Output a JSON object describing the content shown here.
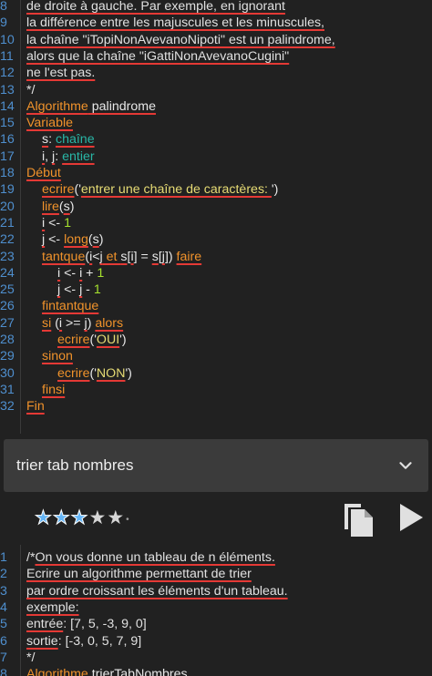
{
  "top_editor": {
    "lines": [
      {
        "n": "8",
        "indent": 0,
        "tokens": [
          {
            "t": "de droite à gauche. Par exemple, en ignorant",
            "c": "cm",
            "u": true
          }
        ]
      },
      {
        "n": "9",
        "indent": 0,
        "tokens": [
          {
            "t": "la différence entre les majuscules et les minuscules,",
            "c": "cm",
            "u": true
          }
        ]
      },
      {
        "n": "10",
        "indent": 0,
        "tokens": [
          {
            "t": "la chaîne \"iTopiNonAvevanoNipoti\" est un palindrome,",
            "c": "cm",
            "u": true
          }
        ]
      },
      {
        "n": "11",
        "indent": 0,
        "tokens": [
          {
            "t": "alors que la chaîne \"iGattiNonAvevanoCugini\"",
            "c": "cm",
            "u": true
          }
        ]
      },
      {
        "n": "12",
        "indent": 0,
        "tokens": [
          {
            "t": "ne l'est pas.",
            "c": "cm",
            "u": true
          }
        ]
      },
      {
        "n": "13",
        "indent": 0,
        "tokens": [
          {
            "t": "*/",
            "c": "cm",
            "u": false
          }
        ]
      },
      {
        "n": "14",
        "indent": 0,
        "tokens": [
          {
            "t": "Algorithme",
            "c": "kw",
            "u": true
          },
          {
            "t": " palindrome",
            "c": "id",
            "u": true
          }
        ]
      },
      {
        "n": "15",
        "indent": 0,
        "tokens": [
          {
            "t": "Variable",
            "c": "kw",
            "u": true
          }
        ]
      },
      {
        "n": "16",
        "indent": 1,
        "tokens": [
          {
            "t": "s",
            "c": "id",
            "u": true
          },
          {
            "t": ": ",
            "c": "op",
            "u": false
          },
          {
            "t": "chaîne",
            "c": "ty",
            "u": true
          }
        ]
      },
      {
        "n": "17",
        "indent": 1,
        "tokens": [
          {
            "t": "i",
            "c": "id",
            "u": true
          },
          {
            "t": ", ",
            "c": "op",
            "u": false
          },
          {
            "t": "j",
            "c": "id",
            "u": true
          },
          {
            "t": ": ",
            "c": "op",
            "u": false
          },
          {
            "t": "entier",
            "c": "ty",
            "u": true
          }
        ]
      },
      {
        "n": "18",
        "indent": 0,
        "tokens": [
          {
            "t": "Début",
            "c": "kw",
            "u": true
          }
        ]
      },
      {
        "n": "19",
        "indent": 1,
        "tokens": [
          {
            "t": "ecrire",
            "c": "kw",
            "u": true
          },
          {
            "t": "('",
            "c": "op",
            "u": false
          },
          {
            "t": "entrer une chaîne de caractères: ",
            "c": "st",
            "u": true
          },
          {
            "t": "')",
            "c": "op",
            "u": false
          }
        ]
      },
      {
        "n": "20",
        "indent": 1,
        "tokens": [
          {
            "t": "lire",
            "c": "kw",
            "u": true
          },
          {
            "t": "(",
            "c": "op",
            "u": false
          },
          {
            "t": "s",
            "c": "id",
            "u": true
          },
          {
            "t": ")",
            "c": "op",
            "u": false
          }
        ]
      },
      {
        "n": "21",
        "indent": 1,
        "tokens": [
          {
            "t": "i",
            "c": "id",
            "u": true
          },
          {
            "t": " <- ",
            "c": "op",
            "u": false
          },
          {
            "t": "1",
            "c": "nu",
            "u": false
          }
        ]
      },
      {
        "n": "22",
        "indent": 1,
        "tokens": [
          {
            "t": "j",
            "c": "id",
            "u": true
          },
          {
            "t": " <- ",
            "c": "op",
            "u": false
          },
          {
            "t": "long",
            "c": "kw",
            "u": true
          },
          {
            "t": "(",
            "c": "op",
            "u": false
          },
          {
            "t": "s",
            "c": "id",
            "u": true
          },
          {
            "t": ")",
            "c": "op",
            "u": false
          }
        ]
      },
      {
        "n": "23",
        "indent": 1,
        "tokens": [
          {
            "t": "tantque",
            "c": "kw",
            "u": true
          },
          {
            "t": "(",
            "c": "op",
            "u": false
          },
          {
            "t": "i",
            "c": "id",
            "u": true
          },
          {
            "t": "<",
            "c": "op",
            "u": false
          },
          {
            "t": "j",
            "c": "id",
            "u": true
          },
          {
            "t": " et ",
            "c": "kw",
            "u": true
          },
          {
            "t": "s",
            "c": "id",
            "u": true
          },
          {
            "t": "[",
            "c": "op",
            "u": false
          },
          {
            "t": "i",
            "c": "id",
            "u": true
          },
          {
            "t": "] = ",
            "c": "op",
            "u": false
          },
          {
            "t": "s",
            "c": "id",
            "u": true
          },
          {
            "t": "[",
            "c": "op",
            "u": false
          },
          {
            "t": "j",
            "c": "id",
            "u": true
          },
          {
            "t": "]) ",
            "c": "op",
            "u": false
          },
          {
            "t": "faire",
            "c": "kw",
            "u": true
          }
        ]
      },
      {
        "n": "24",
        "indent": 2,
        "tokens": [
          {
            "t": "i",
            "c": "id",
            "u": true
          },
          {
            "t": " <- ",
            "c": "op",
            "u": false
          },
          {
            "t": "i",
            "c": "id",
            "u": true
          },
          {
            "t": " + ",
            "c": "op",
            "u": false
          },
          {
            "t": "1",
            "c": "nu",
            "u": false
          }
        ]
      },
      {
        "n": "25",
        "indent": 2,
        "tokens": [
          {
            "t": "j",
            "c": "id",
            "u": true
          },
          {
            "t": " <- ",
            "c": "op",
            "u": false
          },
          {
            "t": "j",
            "c": "id",
            "u": true
          },
          {
            "t": " - ",
            "c": "op",
            "u": false
          },
          {
            "t": "1",
            "c": "nu",
            "u": false
          }
        ]
      },
      {
        "n": "26",
        "indent": 1,
        "tokens": [
          {
            "t": "fintantque",
            "c": "kw",
            "u": true
          }
        ]
      },
      {
        "n": "27",
        "indent": 1,
        "tokens": [
          {
            "t": "si",
            "c": "kw",
            "u": true
          },
          {
            "t": " (",
            "c": "op",
            "u": false
          },
          {
            "t": "i",
            "c": "id",
            "u": true
          },
          {
            "t": " >= ",
            "c": "op",
            "u": false
          },
          {
            "t": "j",
            "c": "id",
            "u": true
          },
          {
            "t": ") ",
            "c": "op",
            "u": false
          },
          {
            "t": "alors",
            "c": "kw",
            "u": true
          }
        ]
      },
      {
        "n": "28",
        "indent": 2,
        "tokens": [
          {
            "t": "ecrire",
            "c": "kw",
            "u": true
          },
          {
            "t": "('",
            "c": "op",
            "u": false
          },
          {
            "t": "OUI",
            "c": "st",
            "u": true
          },
          {
            "t": "')",
            "c": "op",
            "u": false
          }
        ]
      },
      {
        "n": "29",
        "indent": 1,
        "tokens": [
          {
            "t": "sinon",
            "c": "kw",
            "u": true
          }
        ]
      },
      {
        "n": "30",
        "indent": 2,
        "tokens": [
          {
            "t": "ecrire",
            "c": "kw",
            "u": true
          },
          {
            "t": "('",
            "c": "op",
            "u": false
          },
          {
            "t": "NON",
            "c": "st",
            "u": true
          },
          {
            "t": "')",
            "c": "op",
            "u": false
          }
        ]
      },
      {
        "n": "31",
        "indent": 1,
        "tokens": [
          {
            "t": "finsi",
            "c": "kw",
            "u": true
          }
        ]
      },
      {
        "n": "32",
        "indent": 0,
        "tokens": [
          {
            "t": "Fin",
            "c": "kw",
            "u": true
          }
        ]
      }
    ]
  },
  "dropdown": {
    "selected": "trier tab nombres",
    "icon": "chevron-down-icon"
  },
  "toolbar": {
    "rating": 3,
    "rating_max": 5,
    "copy_icon": "copy-icon",
    "run_icon": "play-icon"
  },
  "bottom_editor": {
    "lines": [
      {
        "n": "1",
        "indent": 0,
        "tokens": [
          {
            "t": "/*",
            "c": "cm",
            "u": false
          },
          {
            "t": "On vous donne un tableau de n éléments.",
            "c": "cm",
            "u": true
          }
        ]
      },
      {
        "n": "2",
        "indent": 0,
        "tokens": [
          {
            "t": " Ecrire un algorithme permettant  de trier",
            "c": "cm",
            "u": true
          }
        ]
      },
      {
        "n": "3",
        "indent": 0,
        "tokens": [
          {
            "t": "  par ordre croissant les éléments  d'un tableau.",
            "c": "cm",
            "u": true
          }
        ]
      },
      {
        "n": "4",
        "indent": 0,
        "tokens": [
          {
            "t": "exemple:",
            "c": "cm",
            "u": true
          }
        ]
      },
      {
        "n": "5",
        "indent": 0,
        "tokens": [
          {
            "t": "entrée",
            "c": "cm",
            "u": true
          },
          {
            "t": ": [7, 5, -3, 9, 0]",
            "c": "cm",
            "u": false
          }
        ]
      },
      {
        "n": "6",
        "indent": 0,
        "tokens": [
          {
            "t": "sortie",
            "c": "cm",
            "u": true
          },
          {
            "t": ": [-3, 0, 5, 7, 9]",
            "c": "cm",
            "u": false
          }
        ]
      },
      {
        "n": "7",
        "indent": 0,
        "tokens": [
          {
            "t": "*/",
            "c": "cm",
            "u": false
          }
        ]
      },
      {
        "n": "8",
        "indent": 0,
        "tokens": [
          {
            "t": "Algorithme",
            "c": "kw",
            "u": true
          },
          {
            "t": " trier",
            "c": "id",
            "u": true
          },
          {
            "t": "TabNombres",
            "c": "id",
            "u": true
          }
        ]
      }
    ]
  },
  "colors": {
    "background": "#212121",
    "line_numbers": "#4f8fce",
    "keyword": "#f0922b",
    "type": "#29b6a6",
    "string": "#e6db74",
    "number": "#a6e22e",
    "squiggle": "#e53935",
    "star_active": "#64b5f6"
  }
}
